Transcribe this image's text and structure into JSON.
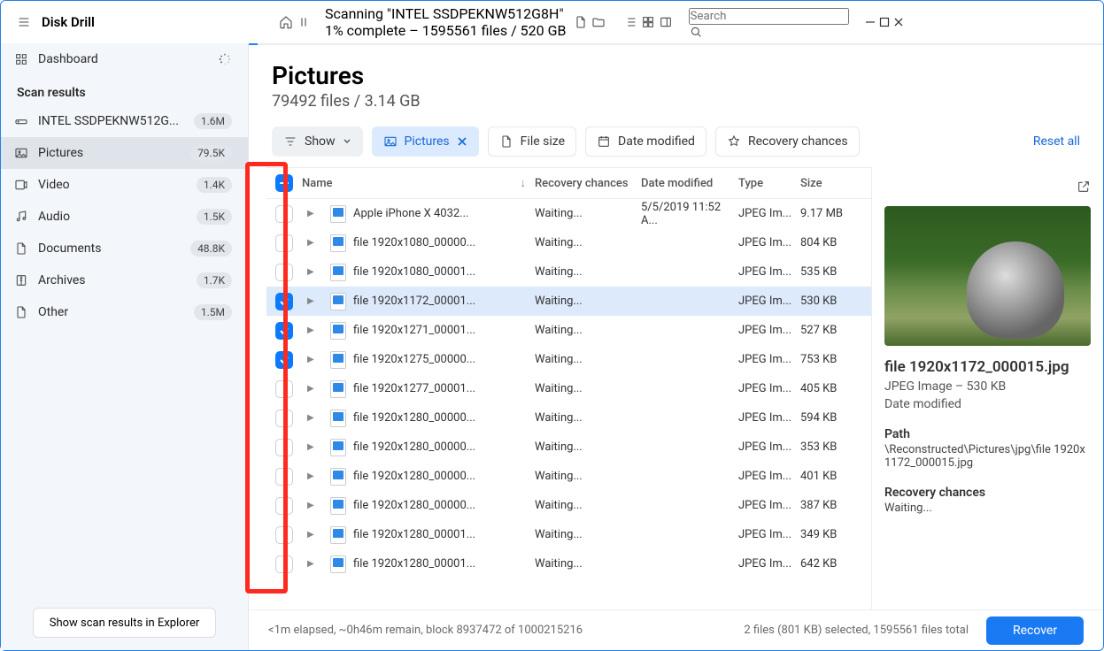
{
  "app": {
    "brand": "Disk Drill",
    "dashboard": "Dashboard"
  },
  "topbar": {
    "title": "Scanning \"INTEL SSDPEKNW512G8H\"",
    "subtitle": "1% complete – 1595561 files / 520 GB",
    "search_placeholder": "Search"
  },
  "sidebar": {
    "section_label": "Scan results",
    "device": {
      "name": "INTEL SSDPEKNW512G...",
      "badge": "1.6M"
    },
    "items": [
      {
        "name": "Pictures",
        "badge": "79.5K",
        "selected": true
      },
      {
        "name": "Video",
        "badge": "1.4K"
      },
      {
        "name": "Audio",
        "badge": "1.5K"
      },
      {
        "name": "Documents",
        "badge": "48.8K"
      },
      {
        "name": "Archives",
        "badge": "1.7K"
      },
      {
        "name": "Other",
        "badge": "1.5M"
      }
    ],
    "bottom_button": "Show scan results in Explorer"
  },
  "main": {
    "heading": "Pictures",
    "subheading": "79492 files / 3.14 GB",
    "filters": {
      "show": "Show",
      "pictures": "Pictures",
      "filesize": "File size",
      "datemod": "Date modified",
      "recovery": "Recovery chances",
      "reset": "Reset all"
    },
    "columns": {
      "name": "Name",
      "rec": "Recovery chances",
      "date": "Date modified",
      "type": "Type",
      "size": "Size"
    },
    "rows": [
      {
        "name": "Apple iPhone X 4032...",
        "rec": "Waiting...",
        "date": "5/5/2019 11:52 A...",
        "type": "JPEG Im...",
        "size": "9.17 MB",
        "checked": false,
        "expand": true
      },
      {
        "name": "file 1920x1080_00000...",
        "rec": "Waiting...",
        "date": "",
        "type": "JPEG Im...",
        "size": "804 KB",
        "checked": false,
        "expand": true
      },
      {
        "name": "file 1920x1080_00001...",
        "rec": "Waiting...",
        "date": "",
        "type": "JPEG Im...",
        "size": "535 KB",
        "checked": false,
        "expand": true
      },
      {
        "name": "file 1920x1172_00001...",
        "rec": "Waiting...",
        "date": "",
        "type": "JPEG Im...",
        "size": "530 KB",
        "checked": true,
        "selected": true,
        "expand": true
      },
      {
        "name": "file 1920x1271_00001...",
        "rec": "Waiting...",
        "date": "",
        "type": "JPEG Im...",
        "size": "527 KB",
        "checked": true,
        "expand": true
      },
      {
        "name": "file 1920x1275_00000...",
        "rec": "Waiting...",
        "date": "",
        "type": "JPEG Im...",
        "size": "753 KB",
        "checked": true,
        "expand": true
      },
      {
        "name": "file 1920x1277_00001...",
        "rec": "Waiting...",
        "date": "",
        "type": "JPEG Im...",
        "size": "405 KB",
        "checked": false,
        "expand": true
      },
      {
        "name": "file 1920x1280_00000...",
        "rec": "Waiting...",
        "date": "",
        "type": "JPEG Im...",
        "size": "594 KB",
        "checked": false,
        "expand": true
      },
      {
        "name": "file 1920x1280_00000...",
        "rec": "Waiting...",
        "date": "",
        "type": "JPEG Im...",
        "size": "353 KB",
        "checked": false,
        "expand": true
      },
      {
        "name": "file 1920x1280_00000...",
        "rec": "Waiting...",
        "date": "",
        "type": "JPEG Im...",
        "size": "401 KB",
        "checked": false,
        "expand": true
      },
      {
        "name": "file 1920x1280_00000...",
        "rec": "Waiting...",
        "date": "",
        "type": "JPEG Im...",
        "size": "387 KB",
        "checked": false,
        "expand": true
      },
      {
        "name": "file 1920x1280_00001...",
        "rec": "Waiting...",
        "date": "",
        "type": "JPEG Im...",
        "size": "349 KB",
        "checked": false,
        "expand": true
      },
      {
        "name": "file 1920x1280_00001...",
        "rec": "Waiting...",
        "date": "",
        "type": "JPEG Im...",
        "size": "642 KB",
        "checked": false,
        "expand": true
      }
    ]
  },
  "preview": {
    "filename": "file 1920x1172_000015.jpg",
    "meta": "JPEG Image – 530 KB",
    "date_label": "Date modified",
    "path_label": "Path",
    "path": "\\Reconstructed\\Pictures\\jpg\\file 1920x1172_000015.jpg",
    "rec_label": "Recovery chances",
    "rec_val": "Waiting..."
  },
  "footer": {
    "status": "<1m elapsed, ~0h46m remain, block 8937472 of 1000215216",
    "selection": "2 files (801 KB) selected, 1595561 files total",
    "recover": "Recover"
  }
}
